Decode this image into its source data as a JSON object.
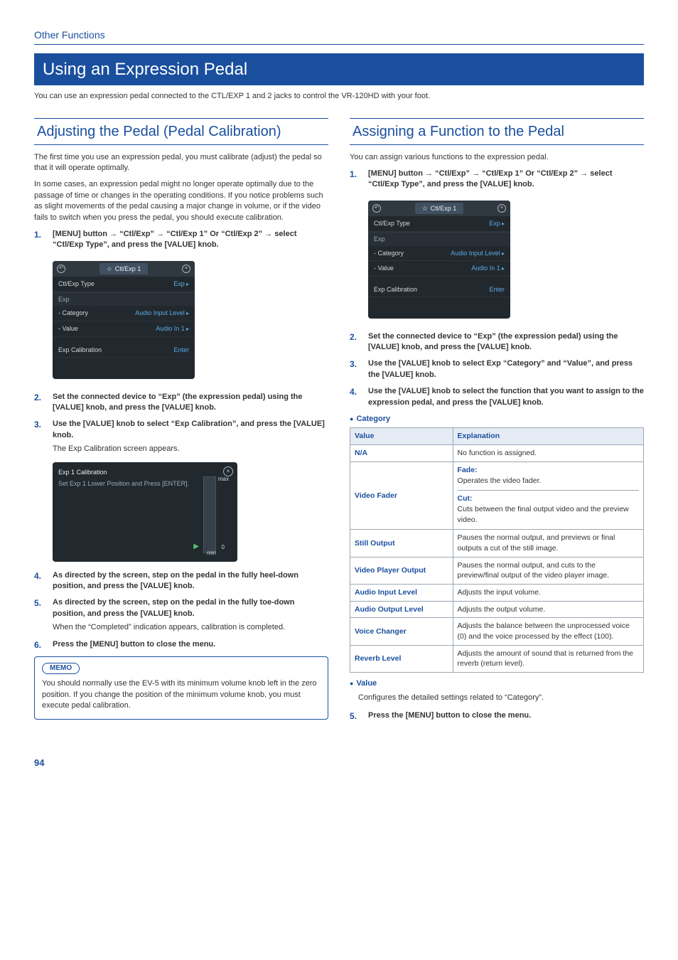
{
  "breadcrumb": "Other Functions",
  "mainTitle": "Using an Expression Pedal",
  "intro": "You can use an expression pedal connected to the CTL/EXP 1 and 2 jacks to control the VR-120HD with your foot.",
  "left": {
    "title": "Adjusting the Pedal (Pedal Calibration)",
    "p1": "The first time you use an expression pedal, you must calibrate (adjust) the pedal so that it will operate optimally.",
    "p2": "In some cases, an expression pedal might no longer operate optimally due to the passage of time or changes in the operating conditions. If you notice problems such as slight movements of the pedal causing a major change in volume, or if the video fails to switch when you press the pedal, you should execute calibration.",
    "step1": "[MENU] button → “Ctl/Exp” → “Ctl/Exp 1” Or “Ctl/Exp 2” → select “Ctl/Exp Type”, and press the [VALUE] knob.",
    "ss1": {
      "tab": "Ctl/Exp 1",
      "rows": [
        {
          "k": "Ctl/Exp Type",
          "v": "Exp"
        },
        {
          "sec": "Exp"
        },
        {
          "k": "- Category",
          "v": "Audio Input Level"
        },
        {
          "k": "- Value",
          "v": "Audio In 1"
        },
        {
          "sp": true
        },
        {
          "k": "Exp Calibration",
          "v": "Enter",
          "noarw": true
        }
      ]
    },
    "step2": "Set the connected device to “Exp” (the expression pedal) using the [VALUE] knob, and press the [VALUE] knob.",
    "step3": "Use the [VALUE] knob to select “Exp Calibration”, and press the [VALUE] knob.",
    "step3note": "The Exp Calibration screen appears.",
    "ss2": {
      "title": "Exp 1 Calibration",
      "msg": "Set Exp 1 Lower Position and Press [ENTER].",
      "max": "max",
      "min": "min",
      "zero": "0"
    },
    "step4": "As directed by the screen, step on the pedal in the fully heel-down position, and press the [VALUE] knob.",
    "step5": "As directed by the screen, step on the pedal in the fully toe-down position, and press the [VALUE] knob.",
    "step5note": "When the “Completed” indication appears, calibration is completed.",
    "step6": "Press the [MENU] button to close the menu.",
    "memoLabel": "MEMO",
    "memo": "You should normally use the EV-5 with its minimum volume knob left in the zero position. If you change the position of the minimum volume knob, you must execute pedal calibration."
  },
  "right": {
    "title": "Assigning a Function to the Pedal",
    "p1": "You can assign various functions to the expression pedal.",
    "step1": "[MENU] button → “Ctl/Exp” → “Ctl/Exp 1” Or “Ctl/Exp 2” → select “Ctl/Exp Type”, and press the [VALUE] knob.",
    "step2": "Set the connected device to “Exp” (the expression pedal) using the [VALUE] knob, and press the [VALUE] knob.",
    "step3": "Use the [VALUE] knob to select Exp “Category” and “Value”, and press the [VALUE] knob.",
    "step4": "Use the [VALUE] knob to select the function that you want to assign to the expression pedal, and press the [VALUE] knob.",
    "catHead": "Category",
    "table": {
      "h1": "Value",
      "h2": "Explanation",
      "rows": [
        {
          "k": "N/A",
          "v": "No function is assigned."
        },
        {
          "k": "Video Fader",
          "lines": [
            {
              "sub": "Fade:",
              "t": "Operates the video fader."
            },
            {
              "sub": "Cut:",
              "t": "Cuts between the final output video and the preview video."
            }
          ]
        },
        {
          "k": "Still Output",
          "v": "Pauses the normal output, and previews or final outputs a cut of the still image."
        },
        {
          "k": "Video Player Output",
          "v": "Pauses the normal output, and cuts to the preview/final output of the video player image."
        },
        {
          "k": "Audio Input Level",
          "v": "Adjusts the input volume."
        },
        {
          "k": "Audio Output Level",
          "v": "Adjusts the output volume."
        },
        {
          "k": "Voice Changer",
          "v": "Adjusts the balance between the unprocessed voice (0) and the voice processed by the effect (100)."
        },
        {
          "k": "Reverb Level",
          "v": "Adjusts the amount of sound that is returned from the reverb (return level)."
        }
      ]
    },
    "valHead": "Value",
    "valBody": "Configures the detailed settings related to “Category”.",
    "step5": "Press the [MENU] button to close the menu."
  },
  "pageNum": "94"
}
